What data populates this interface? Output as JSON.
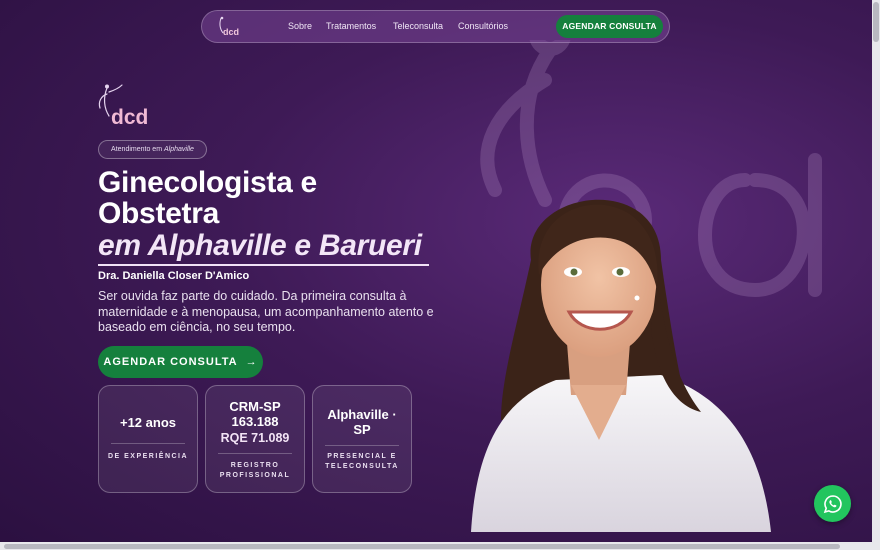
{
  "nav": {
    "logo_text": "dcd",
    "links": [
      "Sobre",
      "Tratamentos",
      "Teleconsulta",
      "Consultórios"
    ],
    "cta": "AGENDAR CONSULTA"
  },
  "hero": {
    "logo_text": "dcd",
    "badge_prefix": "Atendimento em",
    "badge_place": "Alphaville",
    "title_line1": "Ginecologista e",
    "title_line2": "Obstetra",
    "title_em": "em Alphaville e Barueri",
    "doctor": "Dra. Daniella Closer D'Amico",
    "lead": "Ser ouvida faz parte do cuidado. Da primeira consulta à maternidade e à menopausa, um acompanhamento atento e baseado em ciência, no seu tempo.",
    "cta": "AGENDAR CONSULTA",
    "cta_arrow": "→"
  },
  "stats": [
    {
      "value": "+12 anos",
      "value2": "",
      "label": "DE EXPERIÊNCIA"
    },
    {
      "value": "CRM-SP 163.188",
      "value2": "RQE 71.089",
      "label": "REGISTRO PROFISSIONAL"
    },
    {
      "value": "Alphaville · SP",
      "value2": "",
      "label": "PRESENCIAL E TELECONSULTA"
    }
  ],
  "colors": {
    "brand_green": "#15803d",
    "background": "#3e1a56",
    "whatsapp": "#22c55e"
  },
  "icons": [
    "whatsapp-icon",
    "arrow-right-icon",
    "dcd-logo"
  ]
}
